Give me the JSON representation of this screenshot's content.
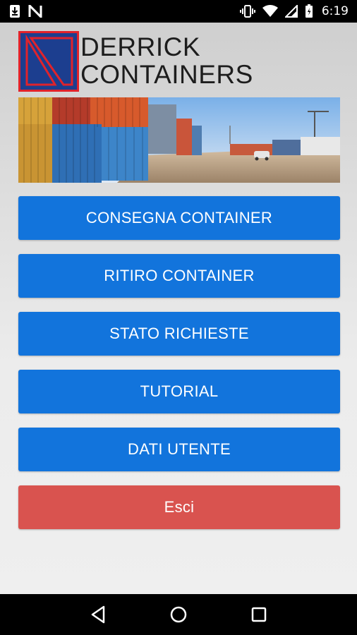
{
  "status_bar": {
    "time": "6:19",
    "icons_left": [
      "download-icon",
      "n-notification-icon"
    ],
    "icons_right": [
      "vibrate-icon",
      "wifi-icon",
      "signal-icon",
      "battery-icon"
    ]
  },
  "brand": {
    "line1": "DERRICK",
    "line2": "CONTAINERS",
    "logo_colors": {
      "frame": "#e1232b",
      "fill": "#1c3e8f"
    }
  },
  "banner": {
    "description_icon": "container-yard-image"
  },
  "menu": {
    "consegna": "CONSEGNA CONTAINER",
    "ritiro": "RITIRO CONTAINER",
    "stato": "STATO RICHIESTE",
    "tutorial": "TUTORIAL",
    "dati": "DATI UTENTE",
    "esci": "Esci"
  },
  "colors": {
    "primary": "#1274dc",
    "danger": "#d9534f"
  },
  "nav_bar": {
    "icons": [
      "back-icon",
      "home-icon",
      "recents-icon"
    ]
  }
}
